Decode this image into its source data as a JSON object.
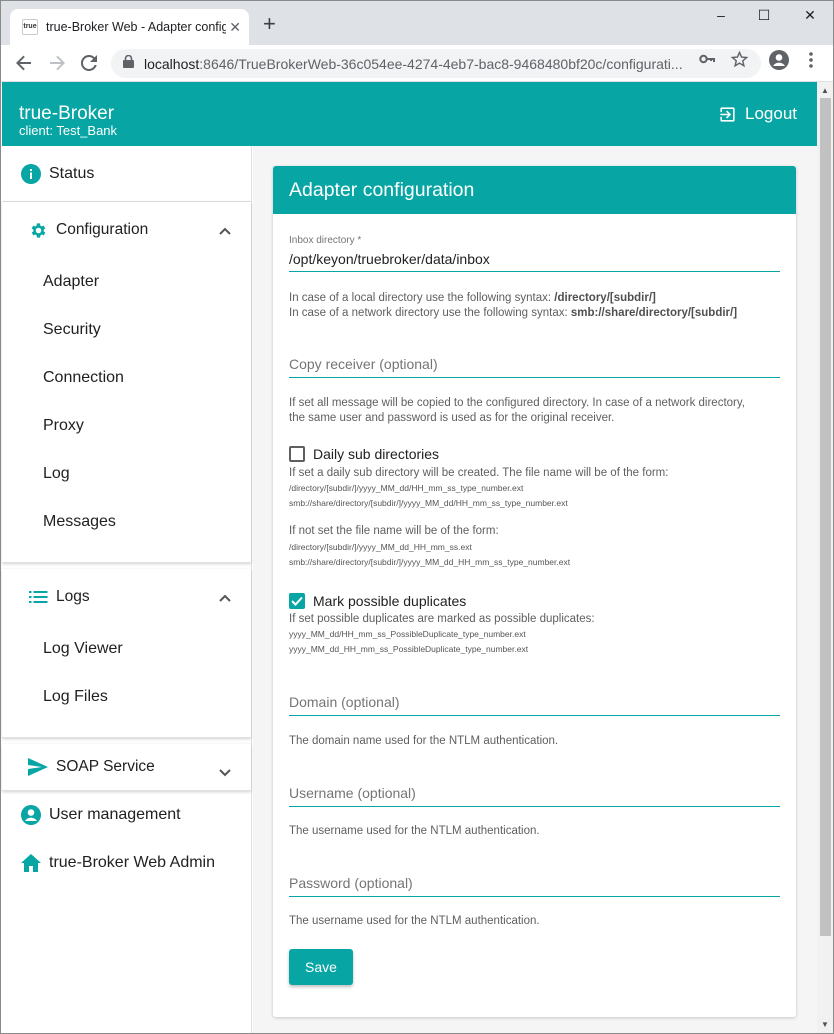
{
  "browser": {
    "tab_title": "true-Broker Web - Adapter configu",
    "favicon_text": "true",
    "new_tab": "+",
    "url_host": "localhost",
    "url_rest": ":8646/TrueBrokerWeb-36c054ee-4274-4eb7-bac8-9468480bf20c/configurati...",
    "min": "–",
    "max": "☐",
    "close": "✕"
  },
  "header": {
    "brand": "true-Broker",
    "client": "client: Test_Bank",
    "logout": "Logout"
  },
  "sidebar": {
    "status": "Status",
    "configuration": {
      "label": "Configuration",
      "items": [
        "Adapter",
        "Security",
        "Connection",
        "Proxy",
        "Log",
        "Messages"
      ]
    },
    "logs": {
      "label": "Logs",
      "items": [
        "Log Viewer",
        "Log Files"
      ]
    },
    "soap": "SOAP Service",
    "user_management": "User management",
    "web_admin": "true-Broker Web Admin"
  },
  "form": {
    "title": "Adapter configuration",
    "inbox_label": "Inbox directory *",
    "inbox_value": "/opt/keyon/truebroker/data/inbox",
    "inbox_hint_1_pre": "In case of a local directory use the following syntax: ",
    "inbox_hint_1_code": "/directory/[subdir/]",
    "inbox_hint_2_pre": "In case of a network directory use the following syntax: ",
    "inbox_hint_2_code": "smb://share/directory/[subdir/]",
    "copy_placeholder": "Copy receiver (optional)",
    "copy_hint_1": "If set all message will be copied to the configured directory. In case of a network directory,",
    "copy_hint_2": "the same user and password is used as for the original receiver.",
    "daily_label": "Daily sub directories",
    "daily_checked": false,
    "daily_hint": "If set a daily sub directory will be created. The file name will be of the form:",
    "daily_ex_1": "/directory/[subdir/]/yyyy_MM_dd/HH_mm_ss_type_number.ext",
    "daily_ex_2": "smb://share/directory/[subdir/]/yyyy_MM_dd/HH_mm_ss_type_number.ext",
    "daily_notset": "If not set the file name will be of the form:",
    "daily_ex_3": "/directory/[subdir/]/yyyy_MM_dd_HH_mm_ss.ext",
    "daily_ex_4": "smb://share/directory/[subdir/]/yyyy_MM_dd_HH_mm_ss_type_number.ext",
    "dup_label": "Mark possible duplicates",
    "dup_checked": true,
    "dup_hint": "If set possible duplicates are marked as possible duplicates:",
    "dup_ex_1": "yyyy_MM_dd/HH_mm_ss_PossibleDuplicate_type_number.ext",
    "dup_ex_2": "yyyy_MM_dd_HH_mm_ss_PossibleDuplicate_type_number.ext",
    "domain_placeholder": "Domain (optional)",
    "domain_hint": "The domain name used for the NTLM authentication.",
    "username_placeholder": "Username (optional)",
    "username_hint": "The username used for the NTLM authentication.",
    "password_placeholder": "Password (optional)",
    "password_hint": "The username used for the NTLM authentication.",
    "save": "Save"
  },
  "colors": {
    "accent": "#07a5a3"
  }
}
